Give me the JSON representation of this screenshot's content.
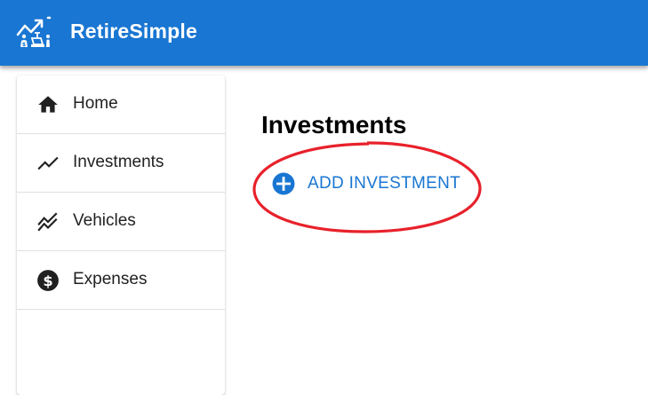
{
  "app": {
    "title": "RetireSimple",
    "brand_color": "#1976d2",
    "logo_icon": "retirement-growth-logo-icon"
  },
  "sidebar": {
    "items": [
      {
        "label": "Home",
        "icon": "home-icon"
      },
      {
        "label": "Investments",
        "icon": "trending-up-icon"
      },
      {
        "label": "Vehicles",
        "icon": "multi-line-chart-icon"
      },
      {
        "label": "Expenses",
        "icon": "dollar-circle-icon"
      }
    ]
  },
  "main": {
    "title": "Investments",
    "add_button": {
      "label": "ADD INVESTMENT",
      "icon": "add-circle-icon",
      "color": "#1976d2"
    }
  },
  "annotation": {
    "shape": "ellipse",
    "color": "#e8212b",
    "highlights": "add-investment-button"
  }
}
